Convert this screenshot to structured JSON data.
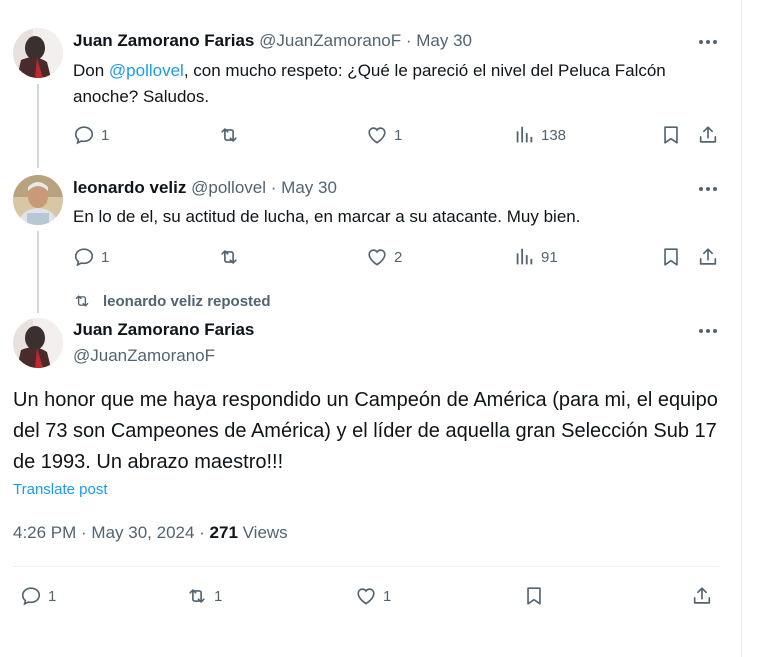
{
  "tweets": [
    {
      "name": "Juan Zamorano Farias",
      "handle": "@JuanZamoranoF",
      "sep": "·",
      "date": "May 30",
      "text_before": "Don ",
      "mention": "@pollovel",
      "text_after": ", con mucho respeto: ¿Qué le pareció el nivel del Peluca Falcón anoche? Saludos.",
      "replies": "1",
      "reposts": "",
      "likes": "1",
      "views": "138"
    },
    {
      "name": "leonardo veliz",
      "handle": "@pollovel",
      "sep": "·",
      "date": "May 30",
      "text": "En lo de el, su actitud de lucha, en marcar a su atacante. Muy bien.",
      "replies": "1",
      "reposts": "",
      "likes": "2",
      "views": "91"
    }
  ],
  "repost_notice": "leonardo veliz reposted",
  "main": {
    "name": "Juan Zamorano Farias",
    "handle": "@JuanZamoranoF",
    "text": "Un honor que me haya respondido un Campeón de América (para mi, el equipo del 73 son Campeones de América) y el líder de aquella gran Selección Sub 17 de 1993. Un abrazo maestro!!!",
    "translate": "Translate post",
    "time": "4:26 PM · May 30, 2024 · ",
    "views_count": "271",
    "views_label": " Views",
    "replies": "1",
    "reposts": "1",
    "likes": "1"
  },
  "icons": [
    "reply-icon",
    "repost-icon",
    "like-icon",
    "views-icon",
    "bookmark-icon",
    "share-icon",
    "more-icon"
  ],
  "colors": {
    "text": "#0f1419",
    "secondary": "#536471",
    "link": "#1d9bf0",
    "thread_line": "#cfd9de",
    "divider": "#eff3f4"
  }
}
